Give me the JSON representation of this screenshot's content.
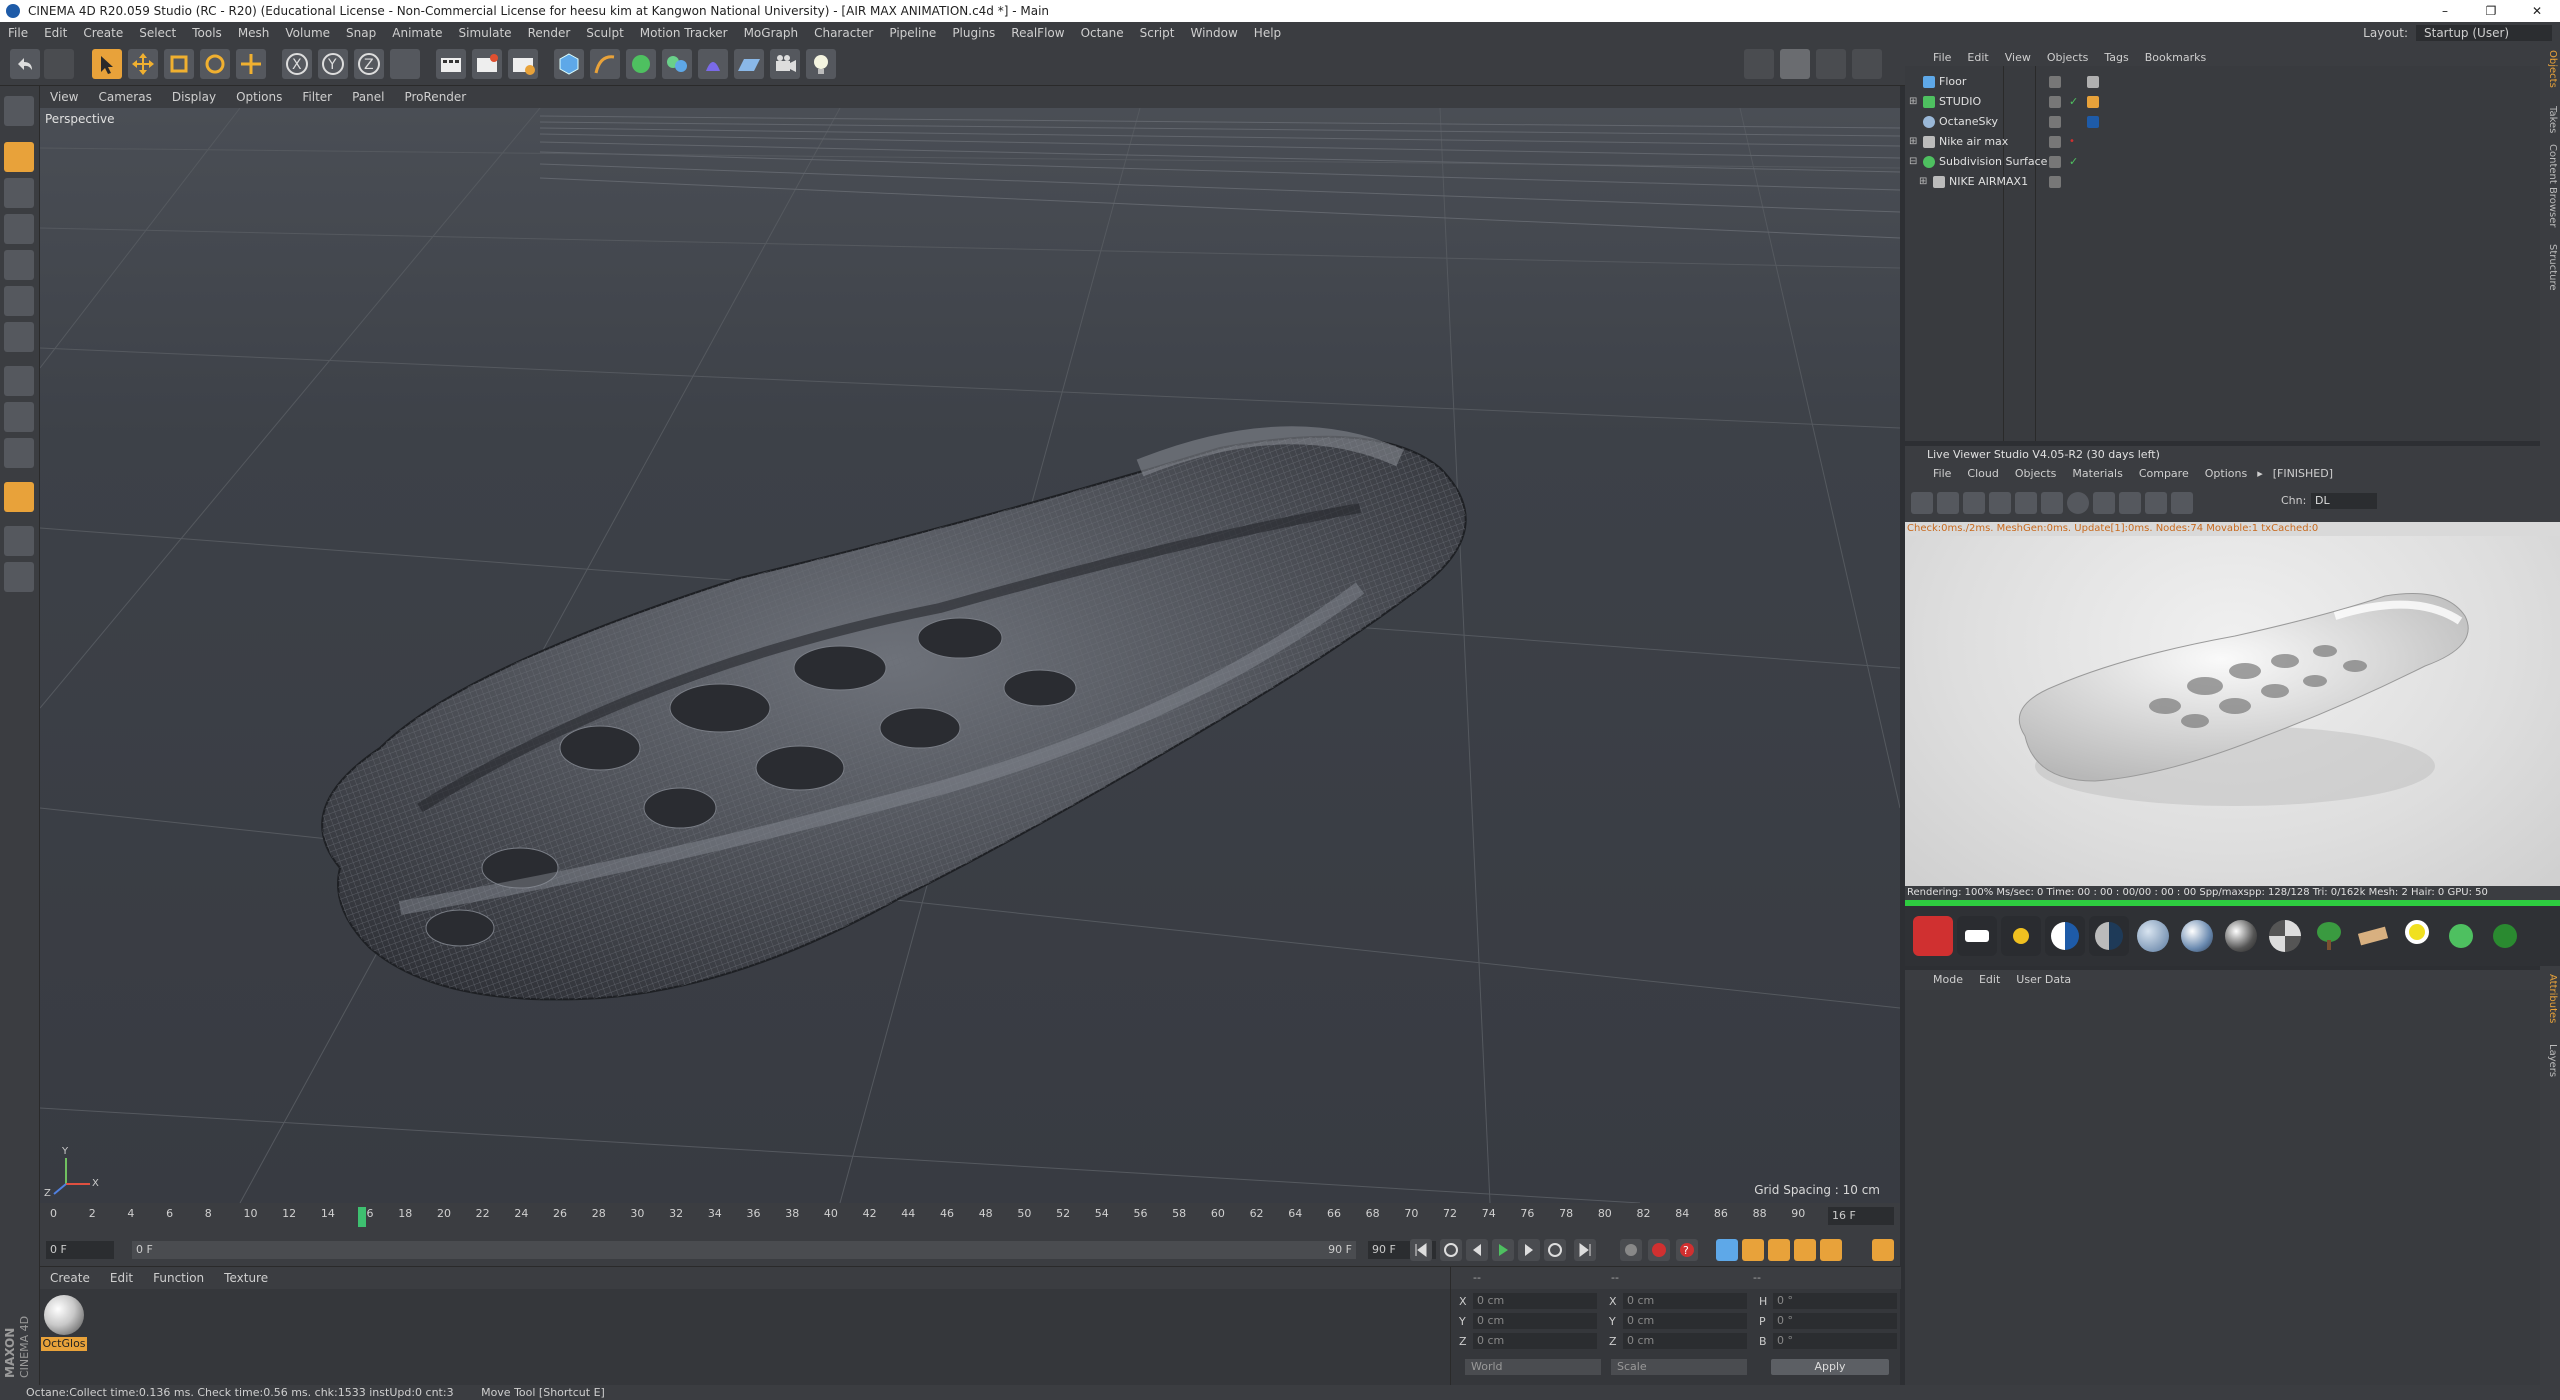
{
  "window": {
    "title": "CINEMA 4D R20.059 Studio (RC - R20) (Educational License - Non-Commercial License for heesu kim at Kangwon National University) - [AIR MAX ANIMATION.c4d *] - Main",
    "min": "–",
    "max": "❐",
    "close": "✕"
  },
  "menubar": [
    "File",
    "Edit",
    "Create",
    "Select",
    "Tools",
    "Mesh",
    "Volume",
    "Snap",
    "Animate",
    "Simulate",
    "Render",
    "Sculpt",
    "Motion Tracker",
    "MoGraph",
    "Character",
    "Pipeline",
    "Plugins",
    "RealFlow",
    "Octane",
    "Script",
    "Window",
    "Help"
  ],
  "layout": {
    "label": "Layout:",
    "value": "Startup (User)"
  },
  "viewport": {
    "menu": [
      "View",
      "Cameras",
      "Display",
      "Options",
      "Filter",
      "Panel",
      "ProRender"
    ],
    "camera": "Perspective",
    "grid_spacing": "Grid Spacing : 10 cm",
    "axis": {
      "x": "X",
      "y": "Y",
      "z": "Z"
    }
  },
  "timeline": {
    "ticks": [
      "0",
      "2",
      "4",
      "6",
      "8",
      "10",
      "12",
      "14",
      "16",
      "18",
      "20",
      "22",
      "24",
      "26",
      "28",
      "30",
      "32",
      "34",
      "36",
      "38",
      "40",
      "42",
      "44",
      "46",
      "48",
      "50",
      "52",
      "54",
      "56",
      "58",
      "60",
      "62",
      "64",
      "66",
      "68",
      "70",
      "72",
      "74",
      "76",
      "78",
      "80",
      "82",
      "84",
      "86",
      "88",
      "90"
    ],
    "current_frame": "16 F",
    "playhead_frame": 16
  },
  "transport": {
    "start": "0 F",
    "range_start": "0 F",
    "range_end": "90 F",
    "end": "90 F"
  },
  "material_panel": {
    "menu": [
      "Create",
      "Edit",
      "Function",
      "Texture"
    ],
    "material_name": "OctGlos"
  },
  "coords": {
    "labels_pos": [
      "X",
      "Y",
      "Z"
    ],
    "labels_size": [
      "X",
      "Y",
      "Z"
    ],
    "labels_rot": [
      "H",
      "P",
      "B"
    ],
    "pos_values": [
      "0 cm",
      "0 cm",
      "0 cm"
    ],
    "size_values": [
      "0 cm",
      "0 cm",
      "0 cm"
    ],
    "rot_values": [
      "0 °",
      "0 °",
      "0 °"
    ],
    "header_left": "--",
    "header_mid": "--",
    "header_right": "--",
    "mode": "World",
    "scale": "Scale",
    "apply": "Apply"
  },
  "statusbar": {
    "left": "Octane:Collect time:0.136 ms.  Check time:0.56 ms.  chk:1533  instUpd:0  cnt:3",
    "right": "Move Tool [Shortcut E]"
  },
  "logo": {
    "brand": "MAXON",
    "product": "CINEMA 4D"
  },
  "object_manager": {
    "menu": [
      "File",
      "Edit",
      "View",
      "Objects",
      "Tags",
      "Bookmarks"
    ],
    "objects": [
      {
        "name": "Floor",
        "indent": 0
      },
      {
        "name": "STUDIO",
        "indent": 0
      },
      {
        "name": "OctaneSky",
        "indent": 0
      },
      {
        "name": "Nike air max",
        "indent": 0
      },
      {
        "name": "Subdivision Surface",
        "indent": 0
      },
      {
        "name": "NIKE AIRMAX1",
        "indent": 1
      }
    ]
  },
  "side_tabs": [
    "Objects",
    "Takes",
    "Content Browser",
    "Structure"
  ],
  "side_tabs_bottom": [
    "Attributes",
    "Layers"
  ],
  "live_viewer": {
    "title": "Live Viewer Studio V4.05-R2 (30 days left)",
    "menu": [
      "File",
      "Cloud",
      "Objects",
      "Materials",
      "Compare",
      "Options",
      "▸",
      "[FINISHED]"
    ],
    "channel_label": "Chn:",
    "channel_value": "DL",
    "status_top": "Check:0ms./2ms. MeshGen:0ms. Update[1]:0ms. Nodes:74 Movable:1 txCached:0",
    "status_bottom": "Rendering: 100%  Ms/sec: 0    Time: 00 : 00 : 00/00 : 00 : 00     Spp/maxspp: 128/128    Tri: 0/162k    Mesh: 2  Hair: 0     GPU:   50"
  },
  "attributes": {
    "menu": [
      "Mode",
      "Edit",
      "User Data"
    ]
  },
  "colors": {
    "accent_orange": "#e8a23a",
    "green_progress": "#2ecc40",
    "panel_bg": "#3b3d41",
    "viewport_bg": "#3b3f46"
  }
}
